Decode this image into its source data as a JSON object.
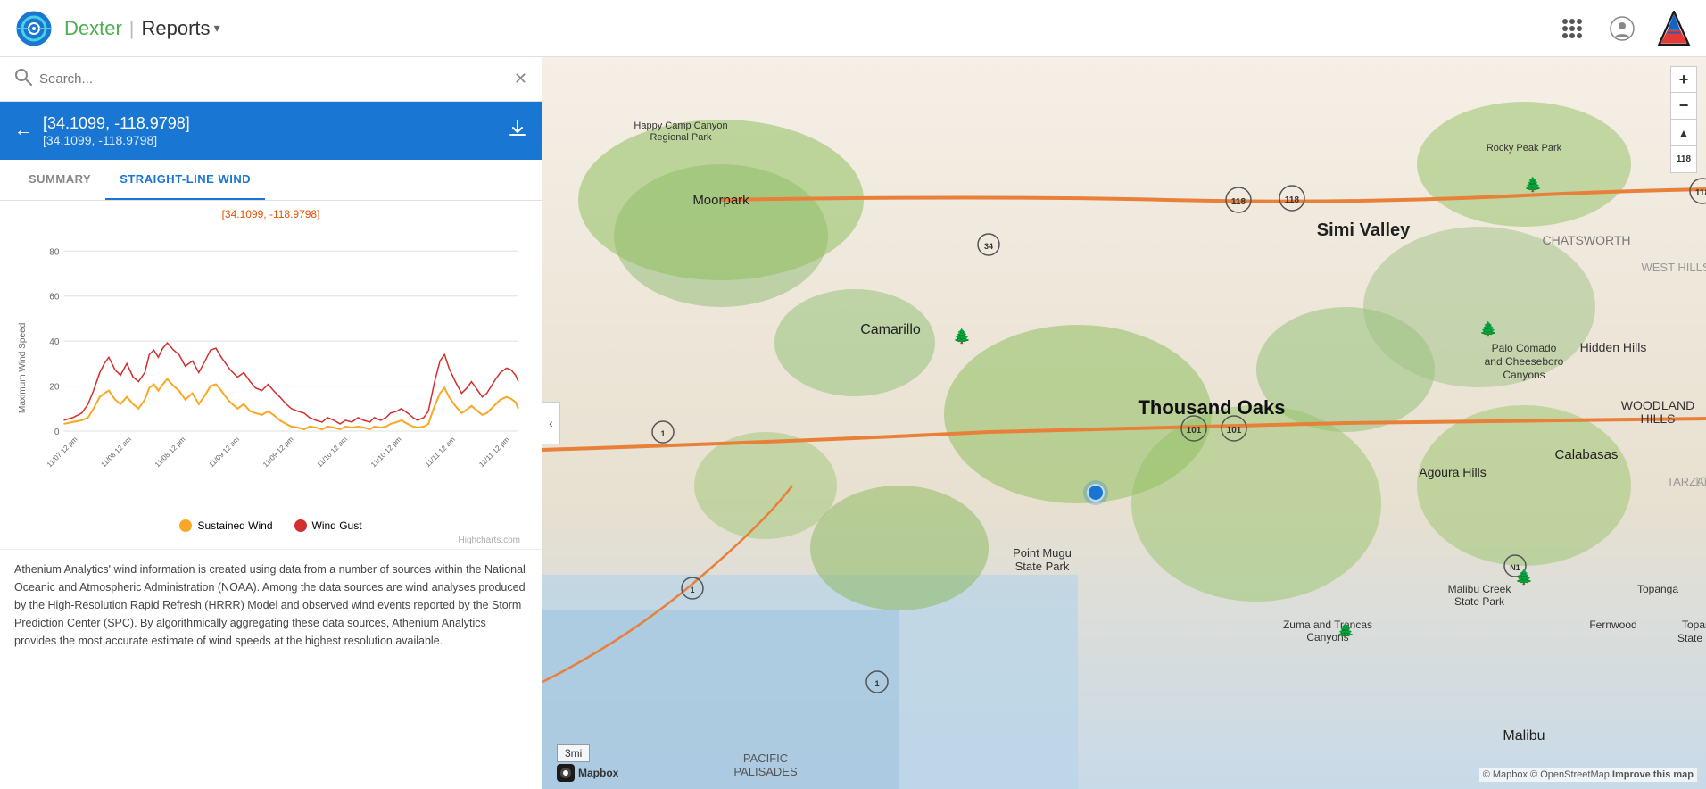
{
  "header": {
    "app_name": "Dexter",
    "divider": "|",
    "reports_label": "Reports",
    "reports_caret": "▾"
  },
  "search": {
    "placeholder": "Search...",
    "clear_label": "✕"
  },
  "location": {
    "coords_main": "[34.1099, -118.9798]",
    "coords_sub": "[34.1099, -118.9798]",
    "back_icon": "←",
    "download_icon": "↓"
  },
  "tabs": [
    {
      "id": "summary",
      "label": "SUMMARY",
      "active": false
    },
    {
      "id": "straight-line-wind",
      "label": "STRAIGHT-LINE WIND",
      "active": true
    }
  ],
  "chart": {
    "subtitle": "[34.1099, -118.9798]",
    "y_axis_label": "Maximum Wind Speed",
    "y_axis_values": [
      "80",
      "60",
      "40",
      "20",
      "0"
    ],
    "x_axis_labels": [
      "11/07 12 pm",
      "11/08 12 am",
      "11/08 12 pm",
      "11/09 12 am",
      "11/09 12 pm",
      "11/10 12 am",
      "11/10 12 pm",
      "11/11 12 am",
      "11/11 12 pm"
    ],
    "legend": [
      {
        "id": "sustained",
        "label": "Sustained Wind",
        "color": "#F9A825"
      },
      {
        "id": "gust",
        "label": "Wind Gust",
        "color": "#D32F2F"
      }
    ],
    "highcharts_credit": "Highcharts.com"
  },
  "description": {
    "text": "Athenium Analytics' wind information is created using data from a number of sources within the National Oceanic and Atmospheric Administration (NOAA). Among the data sources are wind analyses produced by the High-Resolution Rapid Refresh (HRRR) Model and observed wind events reported by the Storm Prediction Center (SPC). By algorithmically aggregating these data sources, Athenium Analytics provides the most accurate estimate of wind speeds at the highest resolution available."
  },
  "map": {
    "location_label": "Thousand Oaks",
    "scale_label": "3mi",
    "attribution": "© Mapbox © OpenStreetMap",
    "improve_label": "Improve this map",
    "zoom_in": "+",
    "zoom_out": "−",
    "north_icon": "▲",
    "collapse_icon": "‹",
    "mapbox_label": "Mapbox"
  }
}
